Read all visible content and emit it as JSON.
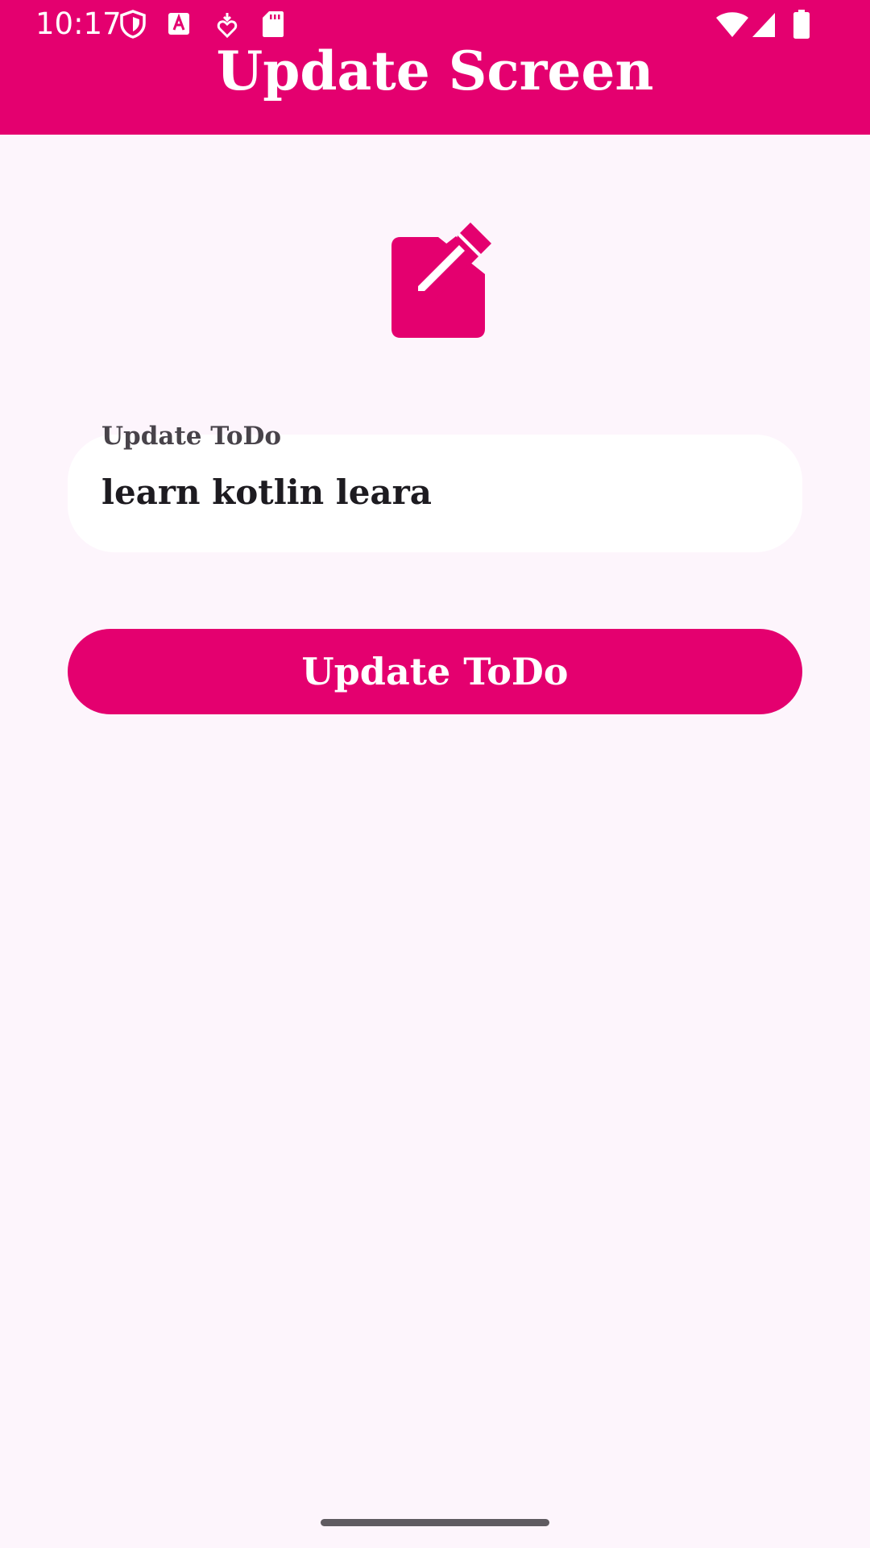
{
  "status_bar": {
    "time": "10:17",
    "left_icons": [
      "shield-icon",
      "font-a-icon",
      "heart-download-icon",
      "sd-card-icon"
    ],
    "right_icons": [
      "wifi-icon",
      "signal-icon",
      "battery-icon"
    ]
  },
  "header": {
    "title": "Update Screen",
    "background_color": "#e4006f"
  },
  "hero": {
    "icon": "edit-pencil-icon",
    "color": "#e4006f"
  },
  "form": {
    "field_label": "Update ToDo",
    "field_value": "learn kotlin leara",
    "button_label": "Update ToDo"
  },
  "colors": {
    "accent": "#e4006f",
    "background": "#fdf5fc",
    "field_background": "#ffffff"
  }
}
